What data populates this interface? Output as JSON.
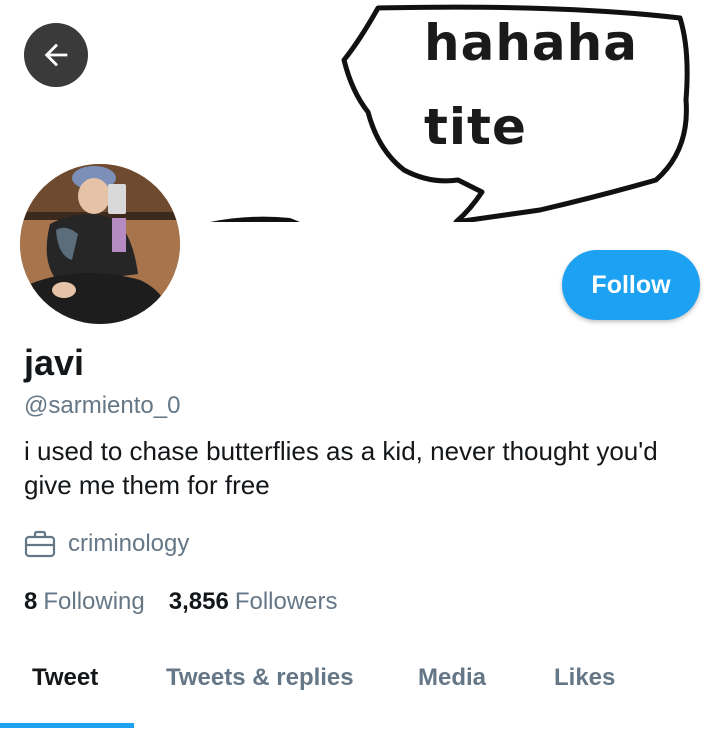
{
  "profile": {
    "name": "javi",
    "handle": "@sarmiento_0",
    "bio": "i used to chase butterflies as a kid, never thought you'd give me them for free",
    "occupation": "criminology",
    "following_count": "8",
    "following_label": "Following",
    "followers_count": "3,856",
    "followers_label": "Followers"
  },
  "banner": {
    "line1": "hahaha",
    "line2": "tite"
  },
  "actions": {
    "follow_label": "Follow",
    "back_icon": "arrow-left-icon"
  },
  "tabs": [
    {
      "label": "Tweet",
      "active": true
    },
    {
      "label": "Tweets & replies",
      "active": false
    },
    {
      "label": "Media",
      "active": false
    },
    {
      "label": "Likes",
      "active": false
    }
  ],
  "colors": {
    "accent": "#1da1f2",
    "text_primary": "#14171a",
    "text_secondary": "#657786"
  }
}
